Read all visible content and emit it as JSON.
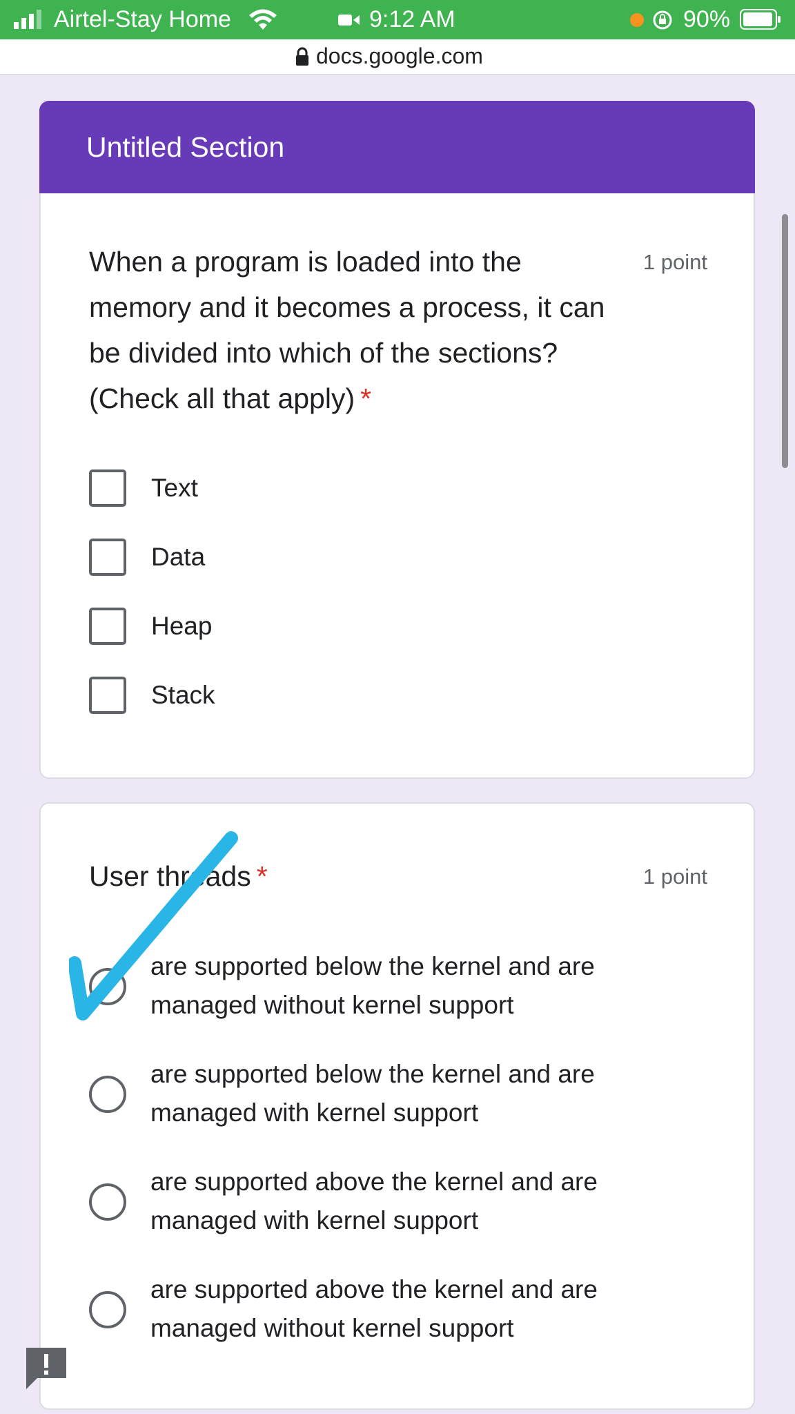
{
  "status_bar": {
    "carrier": "Airtel-Stay Home",
    "time": "9:12 AM",
    "battery": "90%"
  },
  "url_bar": {
    "url": "docs.google.com"
  },
  "section": {
    "title": "Untitled Section",
    "accent_color": "#673ab7"
  },
  "questions": [
    {
      "title": "When a program is loaded into the memory and it becomes a process, it can be divided into which of the sections? (Check all that apply)",
      "required_mark": "*",
      "points": "1 point",
      "type": "checkbox",
      "options": [
        {
          "label": "Text"
        },
        {
          "label": "Data"
        },
        {
          "label": "Heap"
        },
        {
          "label": "Stack"
        }
      ]
    },
    {
      "title": "User threads",
      "required_mark": "*",
      "points": "1 point",
      "type": "radio",
      "options": [
        {
          "label": "are supported below the kernel and are managed without kernel support"
        },
        {
          "label": "are supported below the kernel and are managed with kernel support"
        },
        {
          "label": "are supported above the kernel and are managed with kernel support"
        },
        {
          "label": "are supported above the kernel and are managed without kernel support"
        }
      ]
    }
  ],
  "annotation": {
    "icon": "checkmark-annotation",
    "color": "#29b6e6"
  }
}
